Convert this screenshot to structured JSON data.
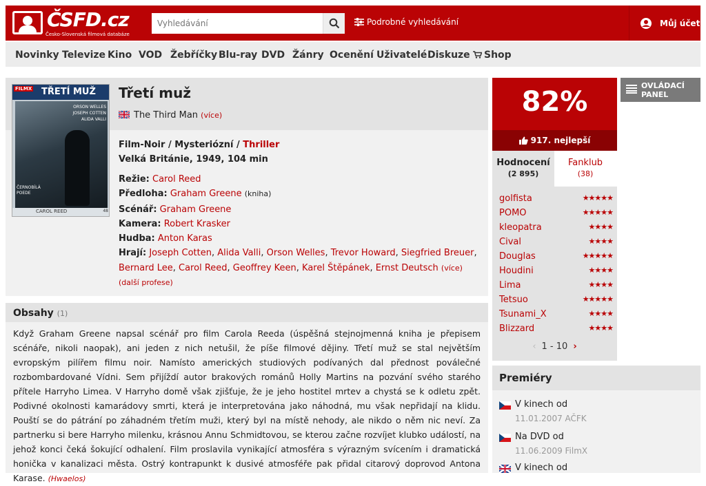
{
  "header": {
    "logo_text": "ČSFD.cz",
    "logo_sub": "Česko-Slovenská filmová databáze",
    "search_placeholder": "Vyhledávání",
    "advanced_search": "Podrobné vyhledávání",
    "account": "Můj účet"
  },
  "nav": [
    "Novinky",
    "Televize",
    "Kino",
    "VOD",
    "Žebříčky",
    "Blu-ray",
    "DVD",
    "Žánry",
    "Ocenění",
    "Uživatelé",
    "Diskuze",
    "Shop"
  ],
  "poster": {
    "filmx": "FILMX",
    "title": "TŘETÍ MUŽ",
    "cast": "ORSON WELLES\nJOSEPH COTTEN\nALIDA VALLI",
    "left_text": "ČERNOBÍLÁ\nPOEDE",
    "director": "CAROL REED",
    "num": "48"
  },
  "film": {
    "title": "Třetí muž",
    "original_title": "The Third Man",
    "more": "(více)",
    "genres_plain": "Film-Noir / Mysteriózní / ",
    "genres_link": "Thriller",
    "origin": "Velká Británie, 1949, 104 min",
    "crew": [
      {
        "role": "Režie:",
        "names": "Carol Reed",
        "note": ""
      },
      {
        "role": "Předloha:",
        "names": "Graham Greene",
        "note": "(kniha)"
      },
      {
        "role": "Scénář:",
        "names": "Graham Greene",
        "note": ""
      },
      {
        "role": "Kamera:",
        "names": "Robert Krasker",
        "note": ""
      },
      {
        "role": "Hudba:",
        "names": "Anton Karas",
        "note": ""
      }
    ],
    "actors_label": "Hrají:",
    "actors_line1": [
      "Joseph Cotten",
      "Alida Valli",
      "Orson Welles",
      "Trevor Howard",
      "Siegfried Breuer"
    ],
    "actors_line2": [
      "Bernard Lee",
      "Carol Reed",
      "Geoffrey Keen",
      "Karel Štěpánek",
      "Ernst Deutsch"
    ],
    "actors_more": "(více)",
    "more_professions": "(další profese)"
  },
  "synopsis": {
    "title": "Obsahy",
    "count": "(1)",
    "text": "Když Graham Greene napsal scénář pro film Carola Reeda (úspěšná stejnojmenná kniha je přepisem scénáře, nikoli naopak), ani jeden z nich netušil, že píše filmové dějiny. Třetí muž se stal největším evropským pilířem filmu noir. Namísto amerických studiových podívaných dal přednost poválečné rozbombardované Vídni. Sem přijíždí autor brakových románů Holly Martins na pozvání svého starého přítele Harryho Limea. V Harryho domě však zjišťuje, že je jeho hostitel mrtev a chystá se k odletu zpět. Podivné okolnosti kamarádovy smrti, která je interpretována jako náhodná, mu však nepřidají na klidu. Pouští se do pátrání po záhadném třetím muži, který byl na místě nehody, ale nikdo o něm nic neví. Za partnerku si bere Harryho milenku, krásnou Annu Schmidtovou, se kterou začne rozvíjet klubko událostí, na jehož konci čeká šokující odhalení. Film proslavila vynikající atmosféra s výrazným svícením i dramatická honička v kanalizaci města. Ostrý kontrapunkt k dusivé atmosféře pak přidal citarový doprovod Antona Karase.",
    "author": "(Hwaelos)"
  },
  "rating": {
    "percent": "82%",
    "rank": "917. nejlepší",
    "tab_ratings": "Hodnocení",
    "tab_ratings_count": "(2 895)",
    "tab_fanclub": "Fanklub",
    "tab_fanclub_count": "(38)",
    "users": [
      {
        "name": "golfista",
        "stars": "★★★★★",
        "count": 5
      },
      {
        "name": "POMO",
        "stars": "★★★★★",
        "count": 5
      },
      {
        "name": "kleopatra",
        "stars": "★★★★",
        "count": 4
      },
      {
        "name": "Cival",
        "stars": "★★★★",
        "count": 4
      },
      {
        "name": "Douglas",
        "stars": "★★★★★",
        "count": 5
      },
      {
        "name": "Houdini",
        "stars": "★★★★",
        "count": 4
      },
      {
        "name": "Lima",
        "stars": "★★★★",
        "count": 4
      },
      {
        "name": "Tetsuo",
        "stars": "★★★★★",
        "count": 5
      },
      {
        "name": "Tsunami_X",
        "stars": "★★★★",
        "count": 4
      },
      {
        "name": "Blizzard",
        "stars": "★★★★",
        "count": 4
      }
    ],
    "pager": "1 - 10",
    "pager_prev": "‹",
    "pager_next": "›"
  },
  "panel": {
    "label": "OVLÁDACÍ\nPANEL"
  },
  "premieres": {
    "title": "Premiéry",
    "items": [
      {
        "label": "V kinech od",
        "date": "11.01.2007 AČFK",
        "flag": "cz"
      },
      {
        "label": "Na DVD od",
        "date": "11.06.2009 FilmX",
        "flag": "cz"
      },
      {
        "label": "V kinech od",
        "date": "",
        "flag": "uk"
      }
    ]
  },
  "colors": {
    "brand": "#ba0305",
    "brand_dark": "#8a0203"
  }
}
